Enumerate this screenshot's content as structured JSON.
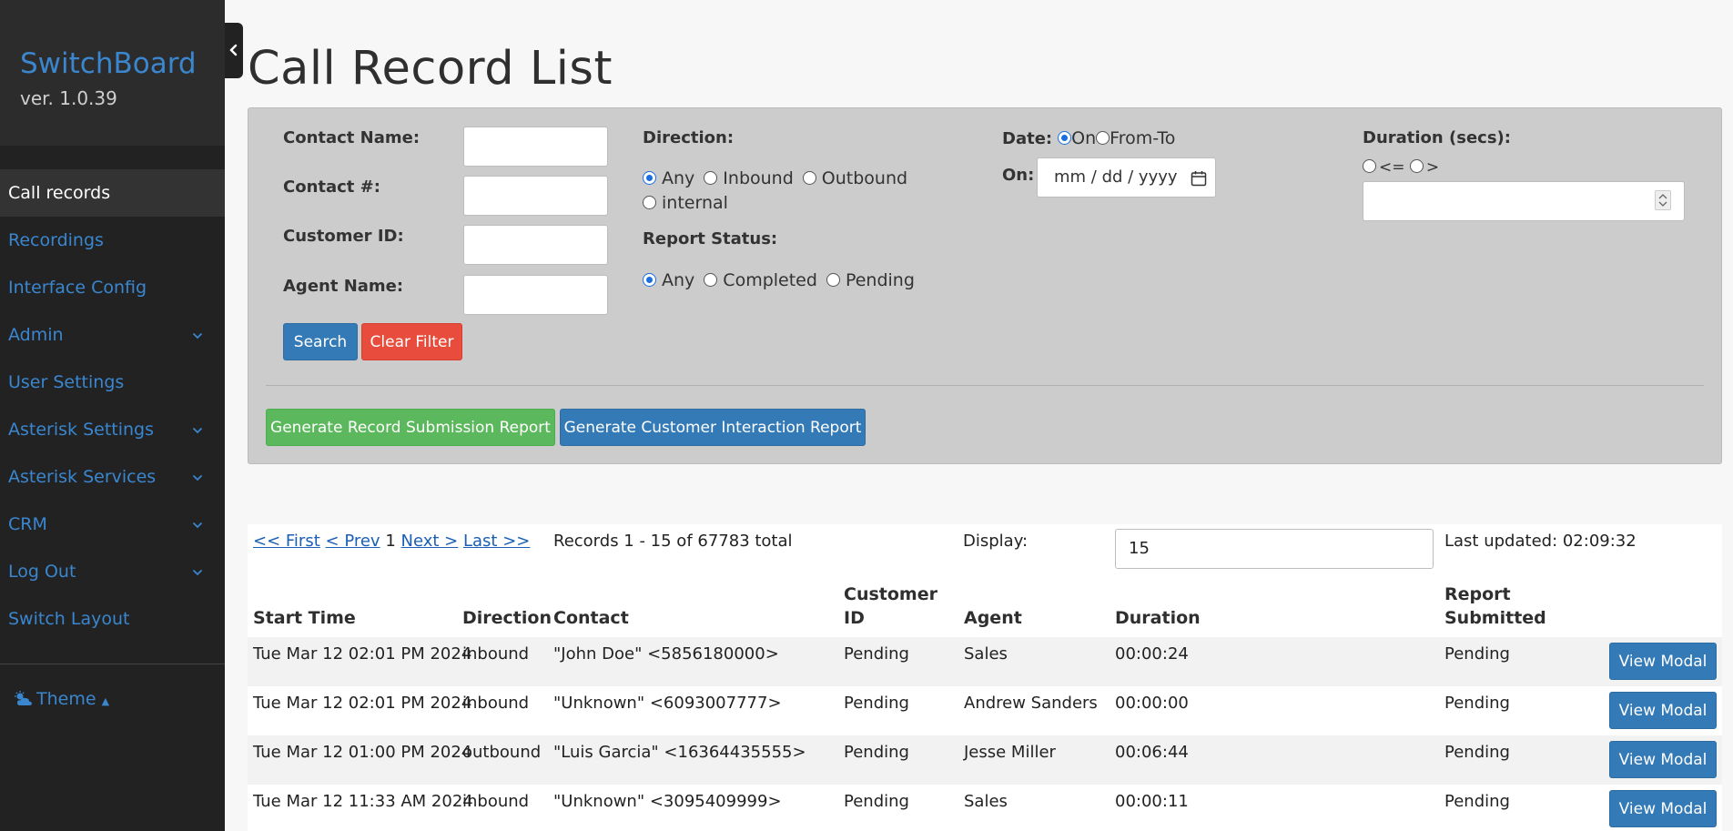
{
  "sidebar": {
    "brand": "SwitchBoard",
    "version": "ver. 1.0.39",
    "items": [
      {
        "label": "Call records",
        "active": true,
        "has_menu": false
      },
      {
        "label": "Recordings",
        "has_menu": false
      },
      {
        "label": "Interface Config",
        "has_menu": false
      },
      {
        "label": "Admin",
        "has_menu": true
      },
      {
        "label": "User Settings",
        "has_menu": false
      },
      {
        "label": "Asterisk Settings",
        "has_menu": true
      },
      {
        "label": "Asterisk Services",
        "has_menu": true
      },
      {
        "label": "CRM",
        "has_menu": true
      },
      {
        "label": "Log Out",
        "has_menu": true
      },
      {
        "label": "Switch Layout",
        "has_menu": false
      }
    ],
    "theme_label": "Theme",
    "theme_icon": "cloud-sun-icon"
  },
  "page_title": "Call Record List",
  "filters": {
    "contact_name_label": "Contact Name:",
    "contact_num_label": "Contact #:",
    "customer_id_label": "Customer ID:",
    "agent_name_label": "Agent Name:",
    "direction_label": "Direction:",
    "direction_options": [
      "Any",
      "Inbound",
      "Outbound",
      "internal"
    ],
    "direction_selected": "Any",
    "report_status_label": "Report Status:",
    "report_status_options": [
      "Any",
      "Completed",
      "Pending"
    ],
    "report_status_selected": "Any",
    "date_label": "Date:",
    "date_mode_on": "On",
    "date_mode_range": "From-To",
    "date_mode_selected": "On",
    "on_label": "On:",
    "date_placeholder": "mm / dd / yyyy",
    "duration_label": "Duration (secs):",
    "duration_lte": "<=",
    "duration_gt": ">",
    "search_button": "Search",
    "clear_button": "Clear Filter",
    "gen_submission_button": "Generate Record Submission Report",
    "gen_interaction_button": "Generate Customer Interaction Report"
  },
  "results": {
    "pager": {
      "first": "<< First",
      "prev": "< Prev",
      "current": "1",
      "next": "Next >",
      "last": "Last >>"
    },
    "record_count": "Records 1 - 15 of 67783 total",
    "display_label": "Display:",
    "display_value": "15",
    "last_updated": "Last updated: 02:09:32",
    "columns": {
      "start_time": "Start Time",
      "direction": "Direction",
      "contact": "Contact",
      "customer_id_1": "Customer",
      "customer_id_2": "ID",
      "agent": "Agent",
      "duration": "Duration",
      "report_1": "Report",
      "report_2": "Submitted"
    },
    "view_button": "View Modal",
    "rows": [
      {
        "start": "Tue Mar 12 02:01 PM 2024",
        "direction": "inbound",
        "contact": "\"John Doe\" <5856180000>",
        "customer_id": "Pending",
        "agent": "Sales",
        "duration": "00:00:24",
        "report": "Pending"
      },
      {
        "start": "Tue Mar 12 02:01 PM 2024",
        "direction": "inbound",
        "contact": "\"Unknown\" <6093007777>",
        "customer_id": "Pending",
        "agent": "Andrew Sanders",
        "duration": "00:00:00",
        "report": "Pending"
      },
      {
        "start": "Tue Mar 12 01:00 PM 2024",
        "direction": "outbound",
        "contact": "\"Luis Garcia\" <16364435555>",
        "customer_id": "Pending",
        "agent": "Jesse Miller",
        "duration": "00:06:44",
        "report": "Pending"
      },
      {
        "start": "Tue Mar 12 11:33 AM 2024",
        "direction": "inbound",
        "contact": "\"Unknown\" <3095409999>",
        "customer_id": "Pending",
        "agent": "Sales",
        "duration": "00:00:11",
        "report": "Pending"
      }
    ]
  },
  "colors": {
    "accent": "#3a86cf",
    "sidebar_bg": "#222222",
    "primary_button": "#337ab7",
    "danger_button": "#e74c3c",
    "success_button": "#5cb85c"
  }
}
